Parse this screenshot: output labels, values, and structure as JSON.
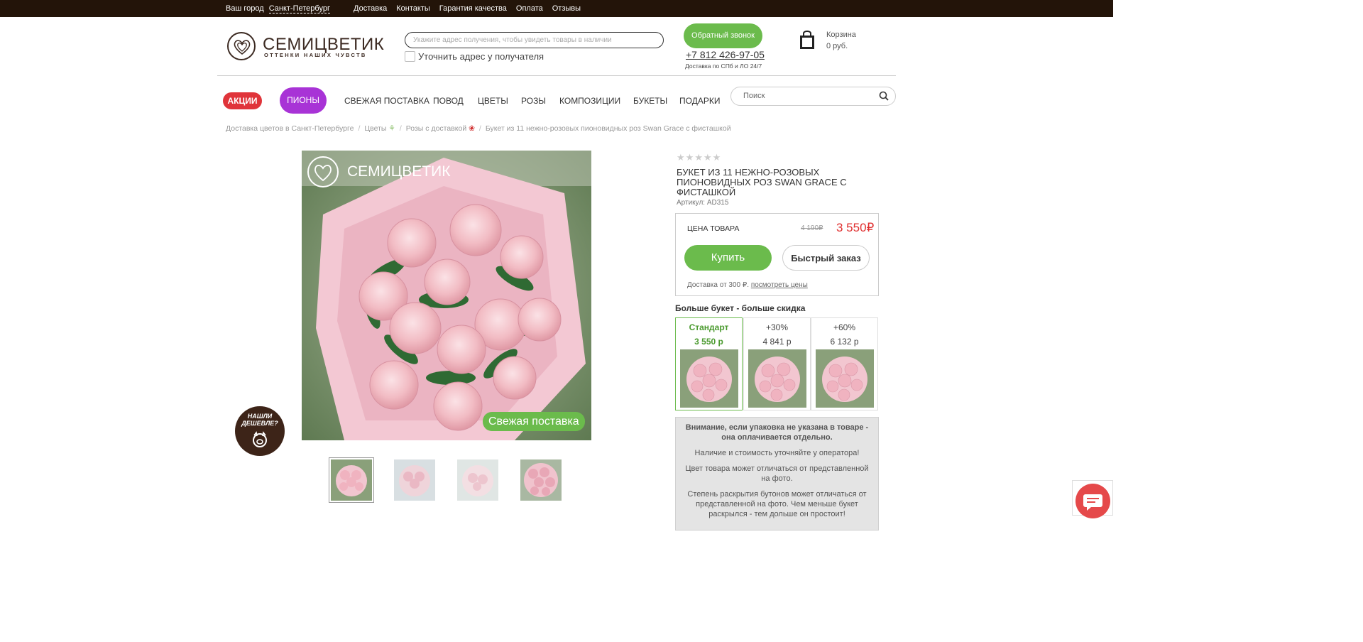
{
  "topbar": {
    "city_label": "Ваш город",
    "city_value": "Санкт-Петербург",
    "nav": [
      "Доставка",
      "Контакты",
      "Гарантия качества",
      "Оплата",
      "Отзывы"
    ]
  },
  "header": {
    "logo_title": "СЕМИЦВЕТИК",
    "logo_subtitle": "ОТТЕНКИ НАШИХ ЧУВСТВ",
    "address_placeholder": "Укажите адрес получения, чтобы увидеть товары в наличии",
    "address_checkbox_label": "Уточнить адрес у получателя",
    "callback_label": "Обратный звонок",
    "phone": "+7 812 426-97-05",
    "phone_note": "Доставка по СПб и ЛО 24/7",
    "cart_title": "Корзина",
    "cart_sum": "0 руб."
  },
  "menu": {
    "sale": "АКЦИИ",
    "peony": "ПИОНЫ",
    "items": [
      "СВЕЖАЯ ПОСТАВКА",
      "ПОВОД",
      "ЦВЕТЫ",
      "РОЗЫ",
      "КОМПОЗИЦИИ",
      "БУКЕТЫ",
      "ПОДАРКИ"
    ],
    "search_placeholder": "Поиск"
  },
  "breadcrumb": [
    "Доставка цветов в Санкт-Петербурге",
    "Цветы",
    "Розы с доставкой",
    "Букет из 11 нежно-розовых пионовидных роз Swan Grace с фисташкой"
  ],
  "product": {
    "photo_logo": "СЕМИЦВЕТИК",
    "fresh_badge": "Свежая поставка",
    "cheaper_label": "НАШЛИ ДЕШЕВЛЕ?",
    "rating": 0,
    "title": "БУКЕТ ИЗ 11 НЕЖНО-РОЗОВЫХ ПИОНОВИДНЫХ РОЗ SWAN GRACE С ФИСТАШКОЙ",
    "sku": "Артикул: AD315",
    "price_label": "ЦЕНА ТОВАРА",
    "old_price": "4 190₽",
    "new_price": "3 550₽",
    "buy_label": "Купить",
    "quick_order_label": "Быстрый заказ",
    "delivery_text": "Доставка от 300 ₽.",
    "delivery_link": "посмотреть цены",
    "more_title": "Больше букет - больше скидка",
    "options": [
      {
        "label": "Стандарт",
        "price": "3 550 р",
        "selected": true
      },
      {
        "label": "+30%",
        "price": "4 841 р",
        "selected": false
      },
      {
        "label": "+60%",
        "price": "6 132 р",
        "selected": false
      }
    ],
    "notice": [
      "Внимание, если упаковка не указана в товаре - она оплачивается отдельно.",
      "Наличие и стоимость уточняйте у оператора!",
      "Цвет товара может отличаться от представленной на фото.",
      "Степень раскрытия бутонов может отличаться от представленной на фото. Чем меньше букет раскрылся - тем дольше он простоит!"
    ]
  },
  "colors": {
    "topbar": "#231409",
    "green": "#6bbb4c",
    "sale_red": "#e0343a",
    "peony_purple": "#a833d6",
    "price_red": "#e03030"
  }
}
